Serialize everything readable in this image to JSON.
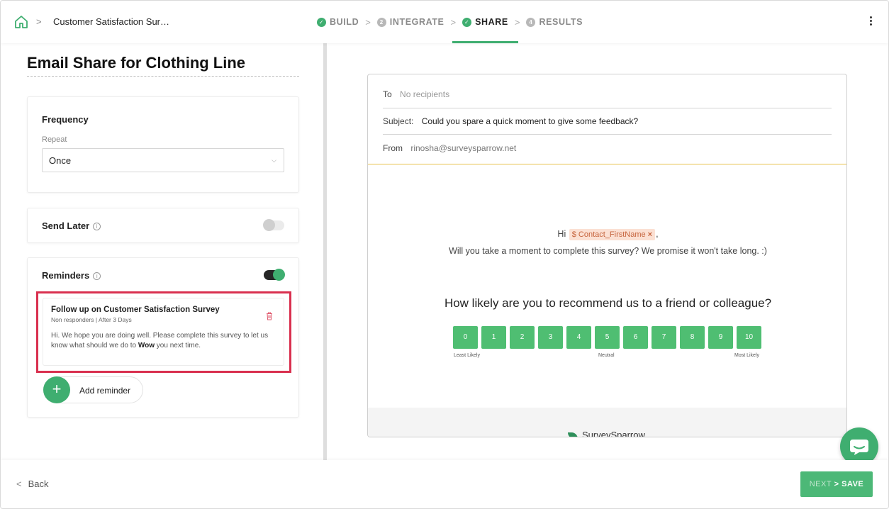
{
  "header": {
    "breadcrumb_sep": ">",
    "survey_title": "Customer Satisfaction Sur…",
    "steps": [
      {
        "label": "BUILD",
        "state": "done",
        "marker": "✓"
      },
      {
        "label": "INTEGRATE",
        "state": "num",
        "marker": "2"
      },
      {
        "label": "SHARE",
        "state": "active",
        "marker": "✓"
      },
      {
        "label": "RESULTS",
        "state": "num",
        "marker": "4"
      }
    ],
    "step_separator": ">"
  },
  "left": {
    "title": "Email Share for Clothing Line",
    "frequency": {
      "title": "Frequency",
      "repeat_label": "Repeat",
      "repeat_value": "Once"
    },
    "send_later": {
      "title": "Send Later",
      "enabled": false
    },
    "reminders": {
      "title": "Reminders",
      "enabled": true,
      "items": [
        {
          "title": "Follow up on Customer Satisfaction Survey",
          "subtitle": "Non responders | After 3 Days",
          "body_prefix": "Hi. We hope you are doing well. Please complete this survey to let us know what should we do to ",
          "body_bold": "Wow",
          "body_suffix": " you next time."
        }
      ],
      "add_label": "Add reminder"
    }
  },
  "email": {
    "to_label": "To",
    "to_placeholder": "No recipients",
    "subject_label": "Subject:",
    "subject_value": "Could you spare a quick moment to give some feedback?",
    "from_label": "From",
    "from_value": "rinosha@surveysparrow.net",
    "greeting_prefix": "Hi",
    "token": "$ Contact_FirstName",
    "token_remove": "×",
    "greeting_suffix": ",",
    "intro": "Will you take a moment to complete this survey? We promise it won't take long. :)",
    "question": "How likely are you to recommend us to a friend or colleague?",
    "scale": [
      "0",
      "1",
      "2",
      "3",
      "4",
      "5",
      "6",
      "7",
      "8",
      "9",
      "10"
    ],
    "scale_labels": {
      "low": "Least Likely",
      "mid": "Neutral",
      "high": "Most Likely"
    },
    "brand": "SurveySparrow"
  },
  "footer": {
    "back_label": "Back",
    "next_label": "NEXT",
    "save_label": "SAVE"
  },
  "colors": {
    "accent": "#3fae70",
    "highlight_border": "#d9304f",
    "scale_button": "#4fbe72",
    "divider_gold": "#e6c14a"
  },
  "icons": {
    "home": "home-icon",
    "kebab": "kebab-menu-icon",
    "info": "info-icon",
    "trash": "trash-icon",
    "chat": "chat-icon"
  }
}
